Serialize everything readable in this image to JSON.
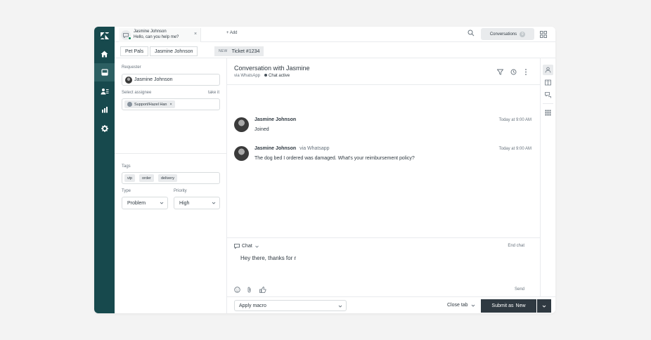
{
  "nav": {
    "items": [
      {
        "icon": "zendesk-logo-icon"
      },
      {
        "icon": "home-icon"
      },
      {
        "icon": "views-icon"
      },
      {
        "icon": "customers-icon"
      },
      {
        "icon": "reporting-icon"
      },
      {
        "icon": "admin-gear-icon"
      }
    ]
  },
  "topbar": {
    "tab": {
      "name": "Jasmine Johnson",
      "message": "Hello, can you help me?",
      "close": "×"
    },
    "add_label": "+ Add",
    "conversations_label": "Conversations",
    "conversations_count": "0"
  },
  "breadcrumb": {
    "org": "Pet Pals",
    "requester": "Jasmine Johnson",
    "status": "NEW",
    "ticket": "Ticket #1234"
  },
  "ticket_fields": {
    "requester_label": "Requester",
    "requester_value": "Jasmine Johnson",
    "assignee_label": "Select assignee",
    "take_it": "take it",
    "assignee_value": "Support/Hazel Han",
    "assignee_remove": "×",
    "tags_label": "Tags",
    "tags": [
      "vip",
      "order",
      "delivery"
    ],
    "type_label": "Type",
    "type_value": "Problem",
    "priority_label": "Priority",
    "priority_value": "High"
  },
  "conversation": {
    "title": "Conversation with Jasmine",
    "via": "via WhatsApp",
    "status": "Chat active",
    "messages": [
      {
        "name": "Jasmine Johnson",
        "via": "",
        "text": "Joined",
        "time": "Today at 9:00 AM"
      },
      {
        "name": "Jasmine Johnson",
        "via": "via Whatsapp",
        "text": "The dog bed I ordered was damaged. What's your reimbursement policy?",
        "time": "Today at 9:00 AM"
      }
    ]
  },
  "composer": {
    "channel": "Chat",
    "end_chat": "End chat",
    "draft": "Hey there, thanks for r",
    "send": "Send"
  },
  "footer": {
    "macro_placeholder": "Apply macro",
    "close_tab": "Close tab",
    "submit_prefix": "Submit as",
    "submit_status": "New"
  },
  "colors": {
    "nav_bg": "#17494d",
    "nav_active": "#2c5f62",
    "submit_bg": "#2f3941",
    "presence": "#038153"
  }
}
